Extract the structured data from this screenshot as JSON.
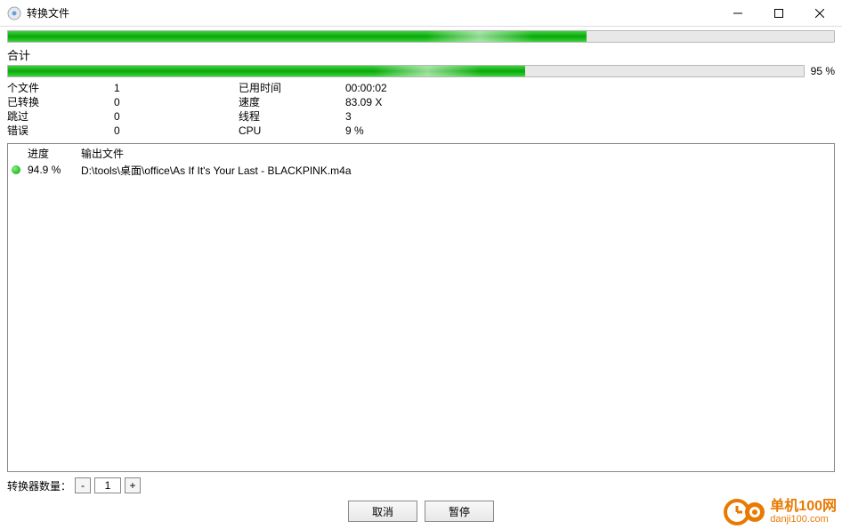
{
  "window": {
    "title": "转换文件"
  },
  "topProgress": {
    "percent": 70
  },
  "totalSection": {
    "label": "合计",
    "percent": 65,
    "percentText": "95 %"
  },
  "stats": {
    "files_label": "个文件",
    "files_value": "1",
    "converted_label": "已转换",
    "converted_value": "0",
    "skipped_label": "跳过",
    "skipped_value": "0",
    "errors_label": "错误",
    "errors_value": "0",
    "elapsed_label": "已用时间",
    "elapsed_value": "00:00:02",
    "speed_label": "速度",
    "speed_value": "83.09 X",
    "threads_label": "线程",
    "threads_value": "3",
    "cpu_label": "CPU",
    "cpu_value": "9 %"
  },
  "fileTable": {
    "header_progress": "进度",
    "header_file": "输出文件",
    "rows": [
      {
        "progress": "94.9 %",
        "file": "D:\\tools\\桌面\\office\\As If It's Your Last - BLACKPINK.m4a"
      }
    ]
  },
  "converterCount": {
    "label": "转换器数量：",
    "value": "1"
  },
  "buttons": {
    "cancel": "取消",
    "pause": "暂停"
  },
  "watermark": {
    "cn": "单机100网",
    "en": "danji100.com"
  }
}
